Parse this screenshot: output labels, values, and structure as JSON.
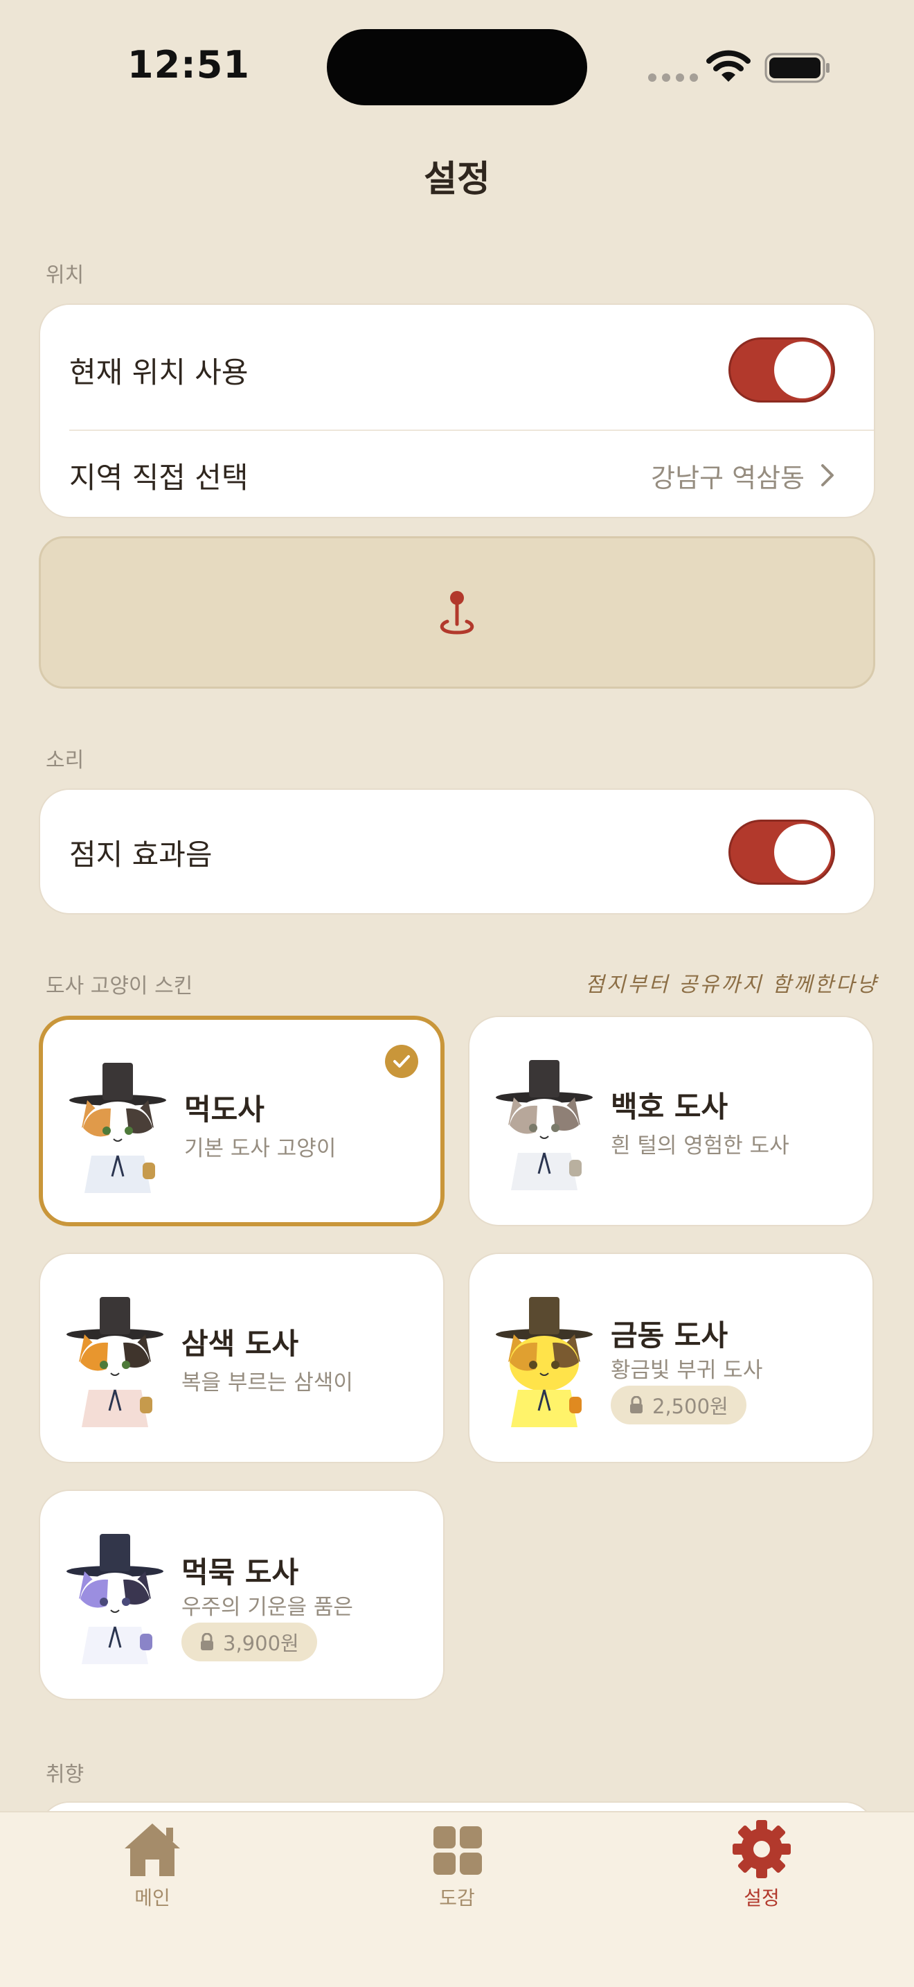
{
  "status_bar": {
    "time": "12:51"
  },
  "nav": {
    "title": "설정"
  },
  "location": {
    "section_label": "위치",
    "use_current_label": "현재 위치 사용",
    "use_current_on": true,
    "region_label": "지역 직접 선택",
    "region_value": "강남구 역삼동"
  },
  "sound": {
    "section_label": "소리",
    "effect_label": "점지 효과음",
    "effect_on": true
  },
  "skins": {
    "section_label": "도사 고양이 스킨",
    "tagline": "점지부터 공유까지 함께한다냥",
    "items": [
      {
        "name": "먹도사",
        "desc": "기본 도사 고양이",
        "selected": true,
        "price": ""
      },
      {
        "name": "백호 도사",
        "desc": "흰 털의 영험한 도사",
        "selected": false,
        "price": ""
      },
      {
        "name": "삼색 도사",
        "desc": "복을 부르는 삼색이",
        "selected": false,
        "price": ""
      },
      {
        "name": "금동 도사",
        "desc": "황금빛 부귀 도사",
        "selected": false,
        "price": "2,500원"
      },
      {
        "name": "먹묵 도사",
        "desc": "우주의 기운을 품은",
        "selected": false,
        "price": "3,900원"
      }
    ]
  },
  "preference": {
    "section_label": "취향"
  },
  "tab_bar": {
    "tabs": [
      {
        "label": "메인",
        "icon": "home-icon",
        "active": false
      },
      {
        "label": "도감",
        "icon": "grid-icon",
        "active": false
      },
      {
        "label": "설정",
        "icon": "gear-icon",
        "active": true
      }
    ]
  },
  "colors": {
    "background": "#ede5d5",
    "accent": "#b2392c",
    "selected_border": "#c9963a",
    "muted_text": "#968d80"
  }
}
